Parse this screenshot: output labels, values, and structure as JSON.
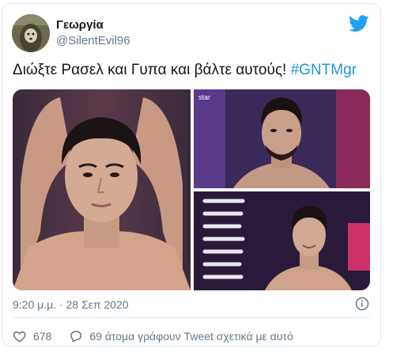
{
  "tweet": {
    "display_name": "Γεωργία",
    "handle": "@SilentEvil96",
    "text": "Διώξτε Ρασελ και Γυπα και βάλτε αυτούς! ",
    "hashtag": "#GNTMgr",
    "timestamp": "9:20 μ.μ. · 28 Σεπ 2020",
    "like_count": "678",
    "reply_text": "69 άτομα γράφουν Tweet σχετικά με αυτό",
    "watermark": "star"
  },
  "colors": {
    "brand": "#1da1f2",
    "hashtag": "#1b95e0",
    "secondary_text": "#657786"
  },
  "icons": {
    "logo": "twitter-bird-icon",
    "like": "heart-outline-icon",
    "reply": "speech-bubble-icon",
    "info": "info-circle-icon"
  }
}
